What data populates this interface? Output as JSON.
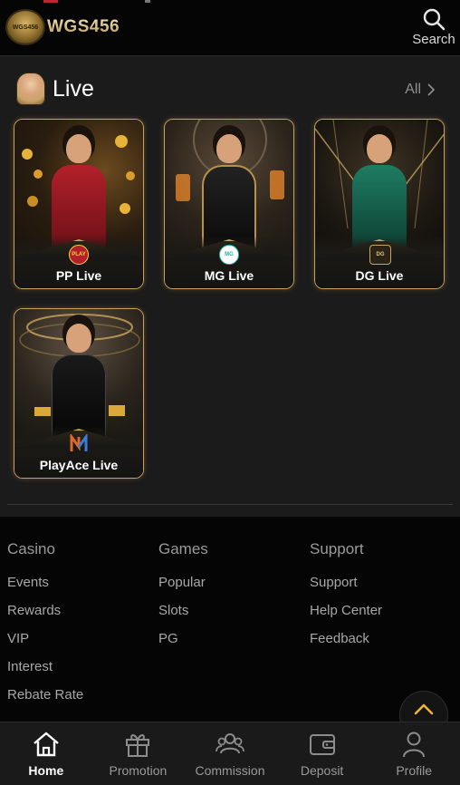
{
  "header": {
    "logo_text": "WGS456",
    "logo_emblem_text": "WGS456",
    "search_label": "Search",
    "search_icon": "search-icon"
  },
  "live_section": {
    "title": "Live",
    "all_label": "All",
    "cards": [
      {
        "label": "PP Live",
        "logo_text": "PLAY",
        "accent": "#b3202a"
      },
      {
        "label": "MG Live",
        "logo_text": "MG",
        "accent": "#21b5a6"
      },
      {
        "label": "DG Live",
        "logo_text": "DG",
        "accent": "#c9a65c"
      },
      {
        "label": "PlayAce Live",
        "logo_text": "N",
        "accent": "#e0672a"
      }
    ]
  },
  "footer": {
    "columns": [
      {
        "heading": "Casino",
        "links": [
          "Events",
          "Rewards",
          "VIP",
          "Interest",
          "Rebate Rate"
        ]
      },
      {
        "heading": "Games",
        "links": [
          "Popular",
          "Slots",
          "PG"
        ]
      },
      {
        "heading": "Support",
        "links": [
          "Support",
          "Help Center",
          "Feedback"
        ]
      }
    ]
  },
  "tabbar": {
    "tabs": [
      {
        "label": "Home",
        "icon": "home-icon",
        "active": true
      },
      {
        "label": "Promotion",
        "icon": "gift-icon",
        "active": false
      },
      {
        "label": "Commission",
        "icon": "users-icon",
        "active": false
      },
      {
        "label": "Deposit",
        "icon": "wallet-icon",
        "active": false
      },
      {
        "label": "Profile",
        "icon": "user-icon",
        "active": false
      }
    ]
  },
  "colors": {
    "gold": "#c8a05a",
    "background": "#0e0e0e",
    "section_bg": "#1b1b1b",
    "accent_chevron": "#f0b43a"
  }
}
